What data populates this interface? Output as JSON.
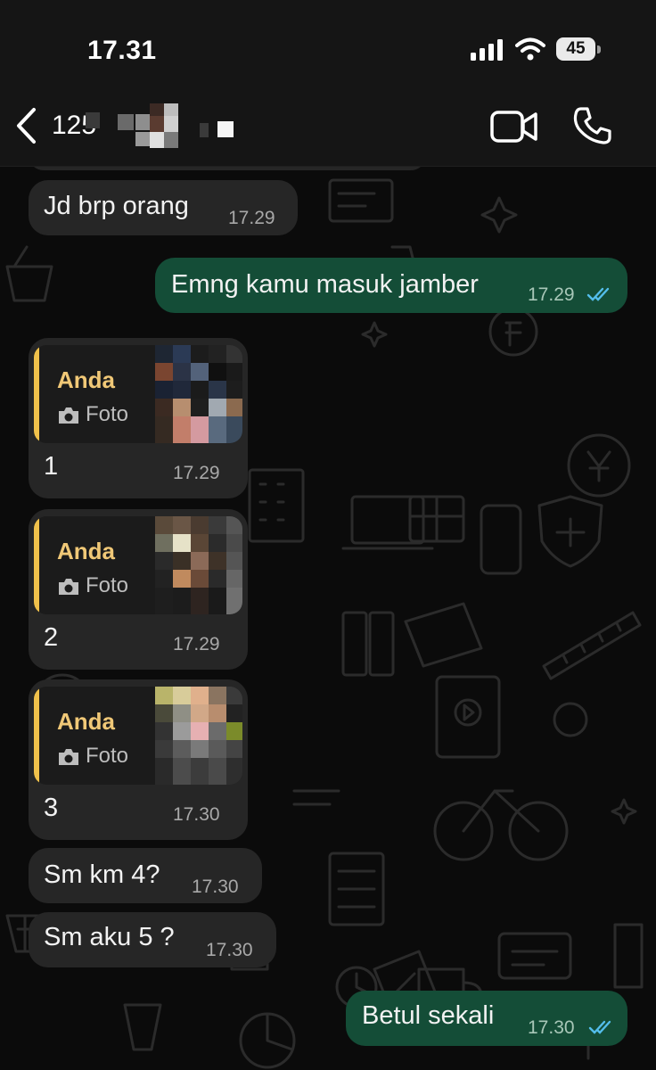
{
  "status_bar": {
    "time": "17.31",
    "battery": "45",
    "battery_level": 0.45
  },
  "header": {
    "contact_name": "125",
    "icons": {
      "back": "chevron-left-icon",
      "video": "video-call-icon",
      "phone": "phone-call-icon"
    }
  },
  "colors": {
    "incoming_bubble": "#262626",
    "outgoing_bubble": "#144d37",
    "quote_accent": "#f0c14b",
    "read_ticks": "#53bdeb"
  },
  "messages": [
    {
      "id": "m1",
      "direction": "in",
      "text": "Jd brp orang",
      "time": "17.29"
    },
    {
      "id": "m2",
      "direction": "out",
      "text": "Emng kamu masuk jamber",
      "time": "17.29",
      "status": "read"
    },
    {
      "id": "m3",
      "direction": "in",
      "reply": {
        "author": "Anda",
        "label": "Foto"
      },
      "text": "1",
      "time": "17.29"
    },
    {
      "id": "m4",
      "direction": "in",
      "reply": {
        "author": "Anda",
        "label": "Foto"
      },
      "text": "2",
      "time": "17.29"
    },
    {
      "id": "m5",
      "direction": "in",
      "reply": {
        "author": "Anda",
        "label": "Foto"
      },
      "text": "3",
      "time": "17.30"
    },
    {
      "id": "m6",
      "direction": "in",
      "text": "Sm km 4?",
      "time": "17.30"
    },
    {
      "id": "m7",
      "direction": "in",
      "text": "Sm aku 5 ?",
      "time": "17.30"
    },
    {
      "id": "m8",
      "direction": "out",
      "text": "Betul sekali",
      "time": "17.30",
      "status": "read"
    }
  ]
}
